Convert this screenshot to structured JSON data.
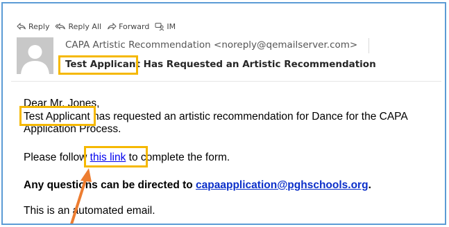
{
  "toolbar": {
    "reply": "Reply",
    "reply_all": "Reply All",
    "forward": "Forward",
    "im": "IM"
  },
  "message": {
    "sender": "CAPA Artistic Recommendation <noreply@qemailserver.com>",
    "subject": "Test Applicant Has Requested an Artistic Recommendation"
  },
  "body": {
    "greeting": "Dear Mr. Jones,",
    "main_name": "Test Applicant",
    "main_rest": " has requested an artistic recommendation for Dance for the CAPA Application Process.",
    "follow_pre": "Please follow ",
    "follow_link": "this link",
    "follow_post": " to complete the form.",
    "questions_pre": "Any questions can be directed to ",
    "questions_email": "capaapplication@pghschools.org",
    "questions_post": ".",
    "automated": "This is an automated email."
  },
  "colors": {
    "frame_border": "#5b9bd5",
    "highlight": "#f5b800",
    "arrow": "#ed7d31",
    "link": "#0000ee"
  }
}
